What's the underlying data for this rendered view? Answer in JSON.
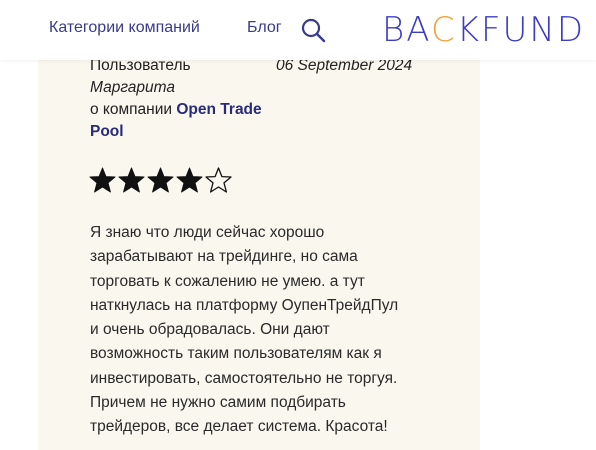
{
  "nav": {
    "categories": "Категории компаний",
    "blog": "Блог",
    "search_icon": "search-icon"
  },
  "logo": {
    "part1": "BA",
    "part2": "C",
    "part3": "KFUND",
    "accent": "#f0a33a",
    "brand": "#3d3dc4"
  },
  "review": {
    "author_label": "Пользователь",
    "author_name": "Маргарита",
    "company_prefix": "о компании",
    "company_name": "Open Trade Pool",
    "date": "06 September 2024",
    "rating": 4,
    "rating_max": 5,
    "text_lines": [
      "Я знаю что люди сейчас хорошо",
      "зарабатывают на трейдинге, но сама",
      "торговать к сожалению не умею. а тут",
      "наткнулась на платформу ОупенТрейдПул",
      "и очень обрадовалась. Они дают",
      "возможность таким пользователям как я",
      "инвестировать, самостоятельно не торгуя.",
      "Причем не нужно самим подбирать",
      "трейдеров, все делает система. Красота!"
    ]
  },
  "colors": {
    "nav_text": "#3a3a8c",
    "card_bg": "#faf7ef"
  }
}
